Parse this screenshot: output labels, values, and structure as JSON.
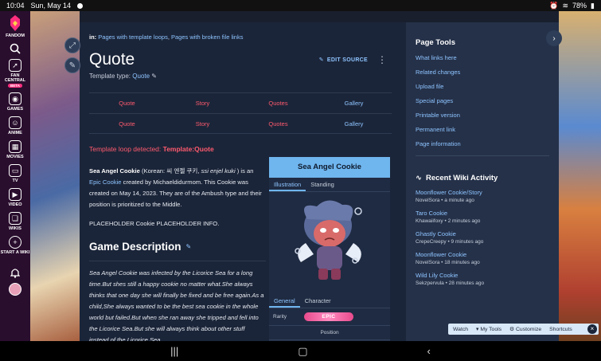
{
  "status": {
    "time": "10:04",
    "date": "Sun, May 14",
    "battery": "78%"
  },
  "rail": {
    "brand": "FANDOM",
    "items": [
      {
        "label": "FAN CENTRAL",
        "badge": "BETA"
      },
      {
        "label": "GAMES"
      },
      {
        "label": "ANIME"
      },
      {
        "label": "MOVIES"
      },
      {
        "label": "TV"
      },
      {
        "label": "VIDEO"
      },
      {
        "label": "WIKIS"
      },
      {
        "label": "START A WIKI"
      }
    ]
  },
  "page": {
    "categories_prefix": "in:",
    "category_1": "Pages with template loops",
    "category_sep": ", ",
    "category_2": "Pages with broken file links",
    "title": "Quote",
    "edit_source": "EDIT SOURCE",
    "template_type_label": "Template type:",
    "template_type_value": "Quote",
    "nav_rows": [
      [
        "Quote",
        "Story",
        "Quotes",
        "Gallery"
      ],
      [
        "Quote",
        "Story",
        "Quotes",
        "Gallery"
      ]
    ],
    "loop_msg": "Template loop detected:",
    "loop_target": "Template:Quote",
    "intro_name": "Sea Angel Cookie",
    "intro_korean_pre": "(Korean: 씨 엔젤 쿠키, ",
    "intro_korean_roman": "ssi enjel kuki",
    "intro_korean_post": ") is an",
    "intro_link": "Epic Cookie",
    "intro_rest": " created by Michaeldidurmom. This Cookie was created on May 14, 2023. They are of the Ambush type and their position is prioritized to the Middle.",
    "placeholder": "PLACEHOLDER Cookie PLACEHOLDER INFO.",
    "section_title": "Game Description",
    "description": "Sea Angel Cookie was infected by the Licorice Sea for a long time.But shes still a happy cookie no matter what.She always thinks that one day she will finally be fixed and be free again.As a child,She always wanted to be the best sea cookie in the whole world but failed.But when she ran away she tripped and fell into the Licorice Sea.But she will always think about other stuff instead of the Licorice Sea."
  },
  "infobox": {
    "title": "Sea Angel Cookie",
    "tabs": [
      "Illustration",
      "Standing"
    ],
    "tabs2": [
      "General",
      "Character"
    ],
    "rarity_label": "Rarity",
    "rarity_value": "EPIC",
    "position_label": "Position"
  },
  "sidebar": {
    "tools_title": "Page Tools",
    "tools": [
      "What links here",
      "Related changes",
      "Upload file",
      "Special pages",
      "Printable version",
      "Permanent link",
      "Page information"
    ],
    "activity_title": "Recent Wiki Activity",
    "activity": [
      {
        "title": "Moonflower Cookie/Story",
        "meta": "NovelSora • a minute ago"
      },
      {
        "title": "Taro Cookie",
        "meta": "Khawaiifoxy • 2 minutes ago"
      },
      {
        "title": "Ghastly Cookie",
        "meta": "CrepeCreepy • 9 minutes ago"
      },
      {
        "title": "Moonflower Cookie",
        "meta": "NovelSora • 18 minutes ago"
      },
      {
        "title": "Wild Lily Cookie",
        "meta": "Sekzpervula • 28 minutes ago"
      }
    ]
  },
  "toolbar": {
    "watch": "Watch",
    "my_tools": "My Tools",
    "customize": "Customize",
    "shortcuts": "Shortcuts"
  },
  "colors": {
    "accent": "#8ec4ff",
    "redlink": "#ff5a6e",
    "infobox_header": "#6fb5ee"
  }
}
